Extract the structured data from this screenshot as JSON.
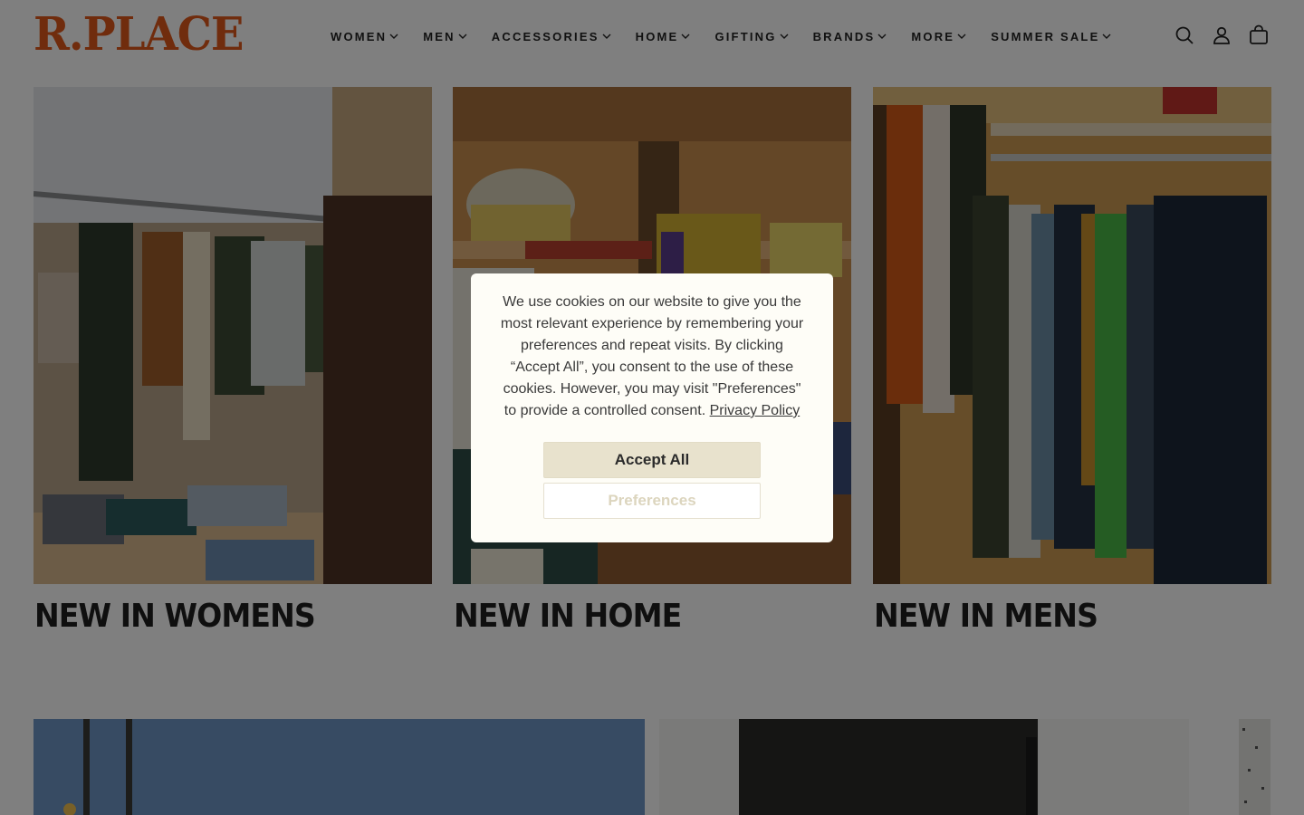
{
  "brand": {
    "logo_text": "R.PLACE",
    "logo_color": "#e0581b"
  },
  "nav": {
    "items": [
      {
        "label": "WOMEN"
      },
      {
        "label": "MEN"
      },
      {
        "label": "ACCESSORIES"
      },
      {
        "label": "HOME"
      },
      {
        "label": "GIFTING"
      },
      {
        "label": "BRANDS"
      },
      {
        "label": "MORE"
      },
      {
        "label": "SUMMER SALE"
      }
    ]
  },
  "header_icons": [
    "search-icon",
    "account-icon",
    "cart-icon"
  ],
  "collections": [
    {
      "title": "NEW IN WOMENS"
    },
    {
      "title": "NEW IN HOME"
    },
    {
      "title": "NEW IN MENS"
    }
  ],
  "cookie_banner": {
    "message": "We use cookies on our website to give you the most relevant experience by remembering your preferences and repeat visits. By clicking “Accept All”, you consent to the use of these cookies. However, you may visit \"Preferences\" to provide a controlled consent.",
    "privacy_link": "Privacy Policy",
    "accept_label": "Accept All",
    "preferences_label": "Preferences"
  },
  "colors": {
    "overlay": "rgba(0,0,0,0.5)",
    "accept_button": "#e8e2cd",
    "modal_bg": "#fefdf7"
  }
}
